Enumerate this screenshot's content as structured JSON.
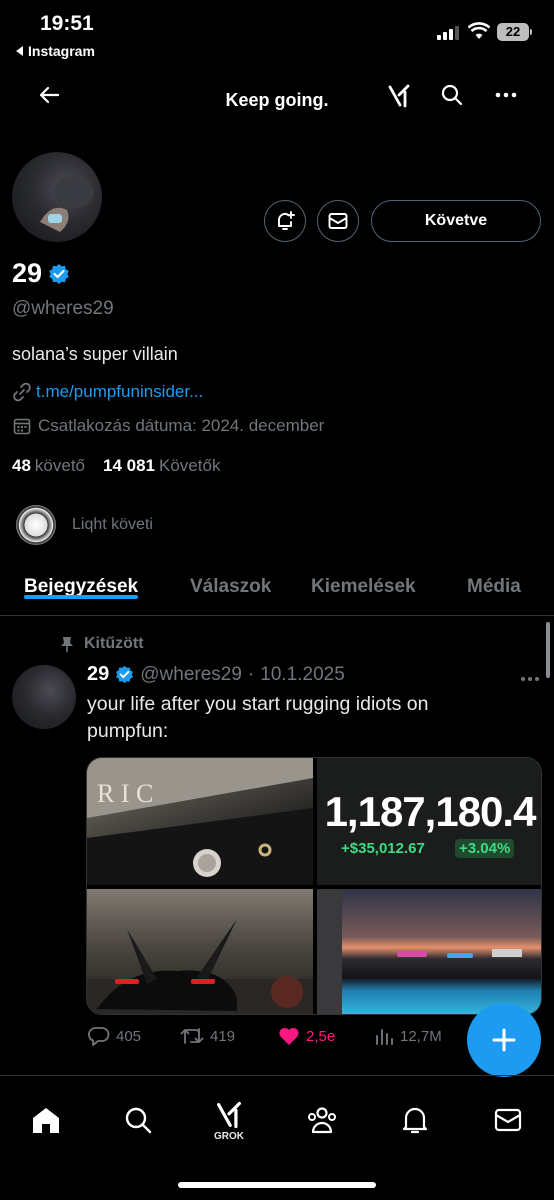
{
  "status_bar": {
    "time": "19:51",
    "back_app": "Instagram",
    "battery": "22"
  },
  "header": {
    "title": "Keep going."
  },
  "profile": {
    "name": "29",
    "handle": "@wheres29",
    "bio": "solana’s super villain",
    "link": "t.me/pumpfuninsider...",
    "joined": "Csatlakozás dátuma: 2024. december",
    "following_count": "48",
    "following_label": "követő",
    "followers_count": "14 081",
    "followers_label": "Követők",
    "followed_by": "Liqht követi",
    "follow_button": "Követve"
  },
  "tabs": [
    "Bejegyzések",
    "Válaszok",
    "Kiemelések",
    "Média"
  ],
  "post": {
    "pinned_label": "Kitűzött",
    "author": "29",
    "handle": "@wheres29",
    "dot": "·",
    "date": "10.1.2025",
    "text": "your life after you start rugging idiots on pumpfun:",
    "media_balance": "1,187,180.4",
    "media_change": "+$35,012.67",
    "media_pct": "+3.04%",
    "replies": "405",
    "reposts": "419",
    "likes": "2,5e",
    "views": "12,7M"
  },
  "bottom_nav": {
    "grok_label": "GROK"
  },
  "colors": {
    "accent": "#1d9bf0",
    "like": "#f91880",
    "muted": "#71767b"
  }
}
